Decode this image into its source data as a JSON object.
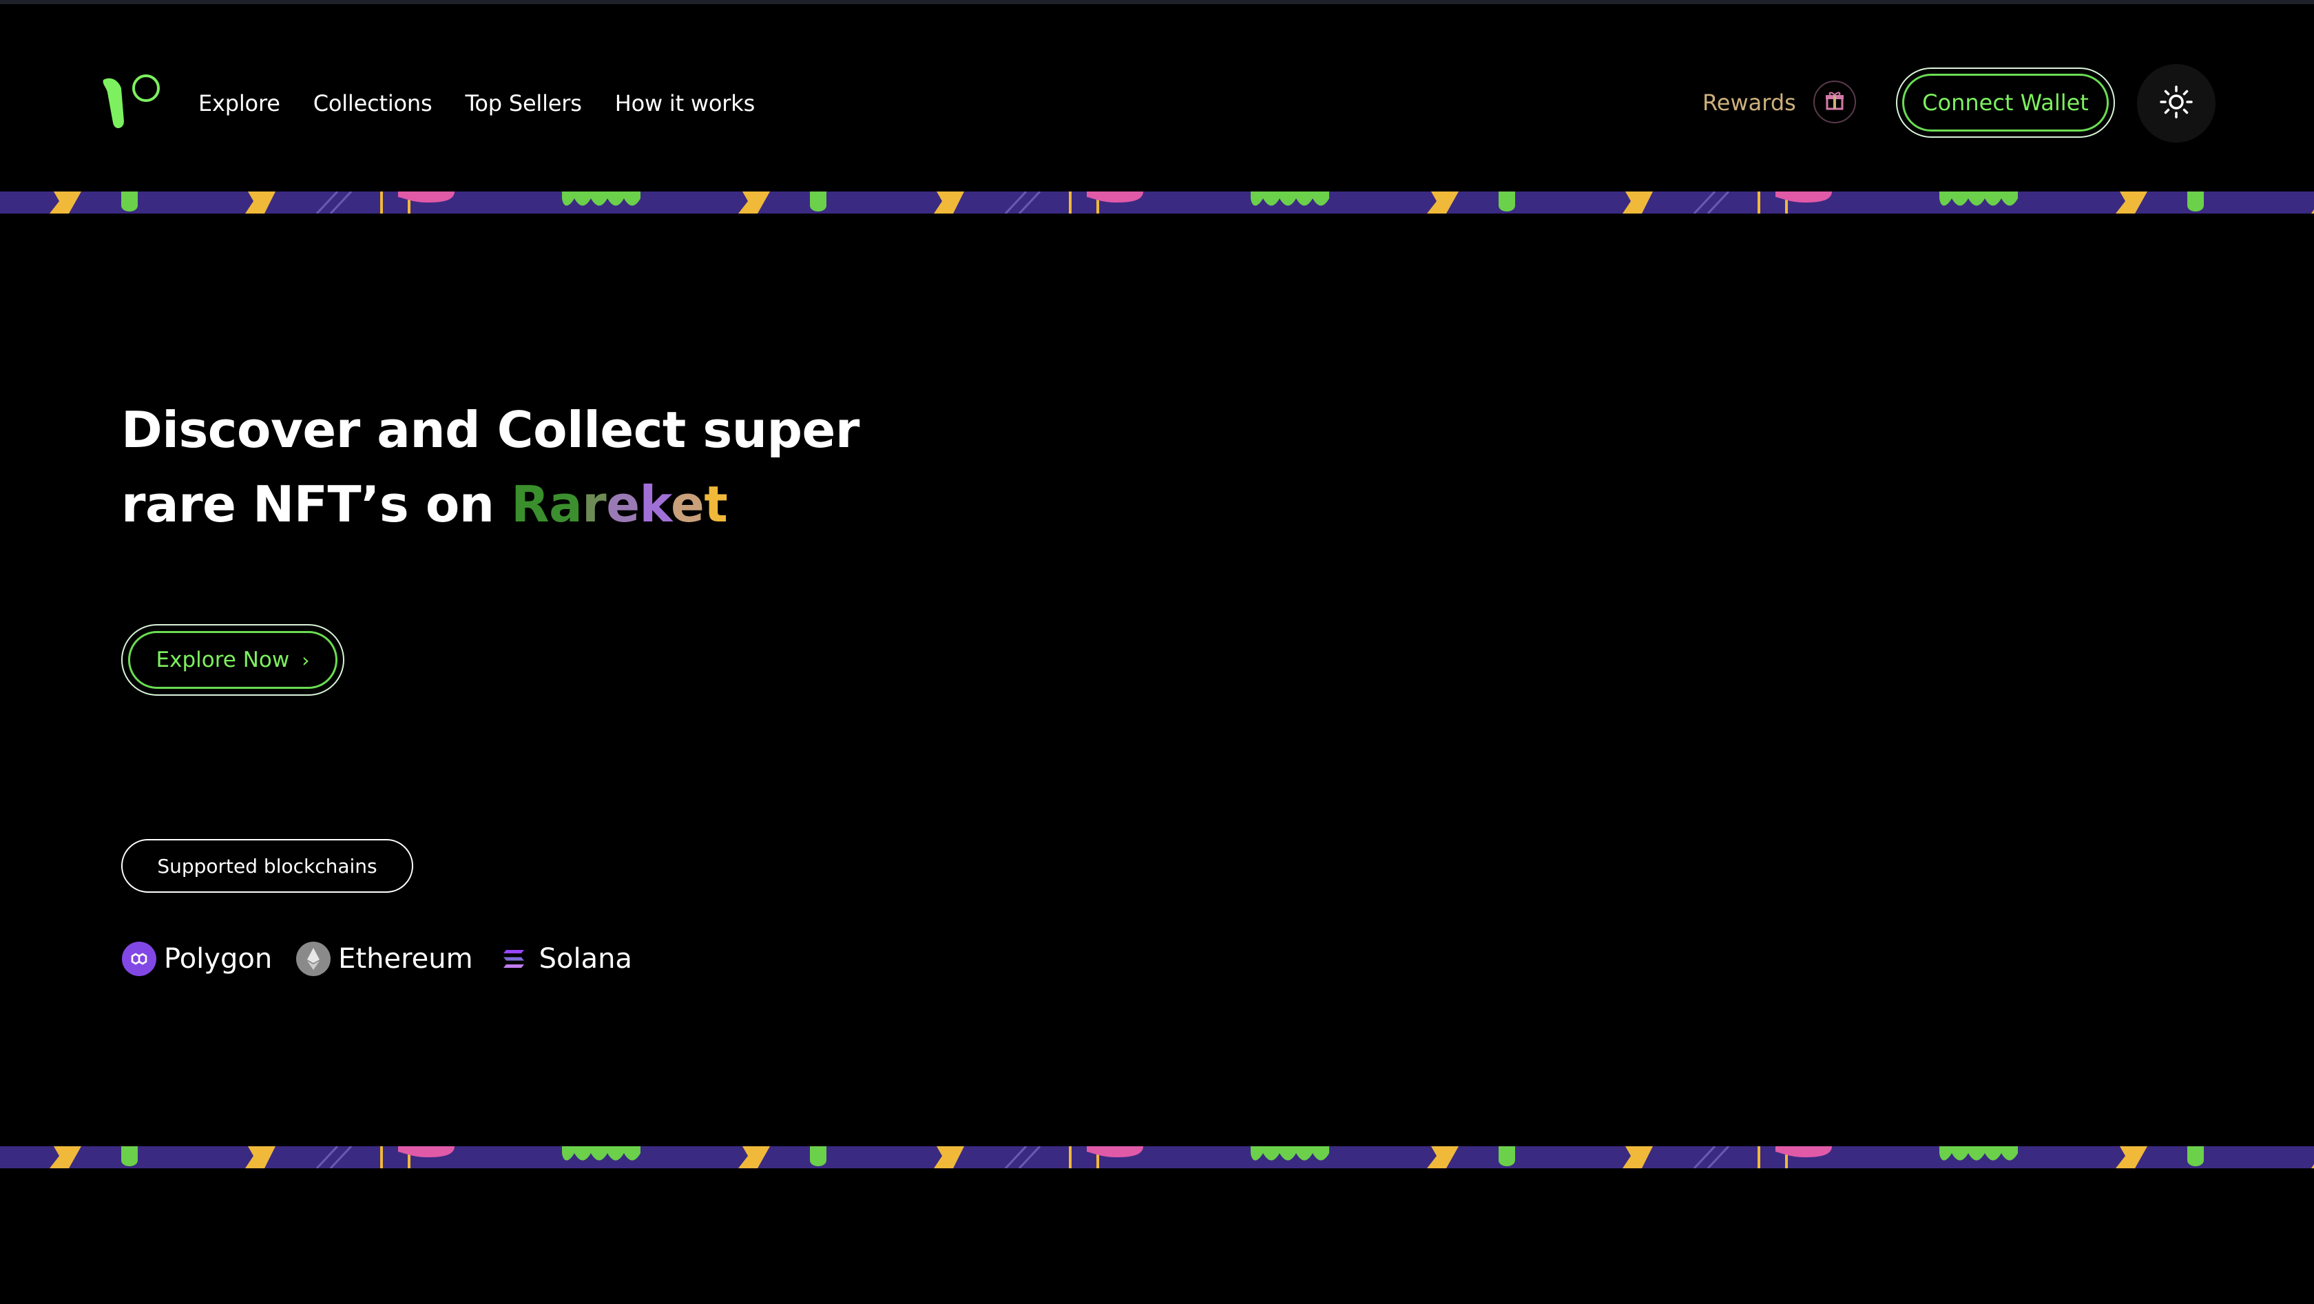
{
  "header": {
    "logo_icon": "rareket-logo-icon",
    "nav": [
      {
        "label": "Explore"
      },
      {
        "label": "Collections"
      },
      {
        "label": "Top Sellers"
      },
      {
        "label": "How it works"
      }
    ],
    "rewards_label": "Rewards",
    "gift_icon": "gift-icon",
    "connect_wallet_label": "Connect Wallet",
    "theme_icon": "sun-icon"
  },
  "hero": {
    "title_line1": "Discover and Collect super",
    "title_line2_prefix": "rare NFT’s on ",
    "brand_letters": [
      {
        "char": "R",
        "color": "#3a8f2c"
      },
      {
        "char": "a",
        "color": "#3c8f2e"
      },
      {
        "char": "r",
        "color": "#6f8b55"
      },
      {
        "char": "e",
        "color": "#9a7ab4"
      },
      {
        "char": "k",
        "color": "#a070d6"
      },
      {
        "char": "e",
        "color": "#c9a07a"
      },
      {
        "char": "t",
        "color": "#f0b93a"
      }
    ],
    "explore_label": "Explore Now",
    "explore_icon": "chevron-right-icon"
  },
  "blockchains": {
    "badge_label": "Supported blockchains",
    "items": [
      {
        "label": "Polygon",
        "icon": "polygon-icon"
      },
      {
        "label": "Ethereum",
        "icon": "ethereum-icon"
      },
      {
        "label": "Solana",
        "icon": "solana-icon"
      }
    ]
  },
  "colors": {
    "accent_green": "#7df05f",
    "stripe_bg": "#3b2a82",
    "rewards_text": "#cdb07d"
  }
}
